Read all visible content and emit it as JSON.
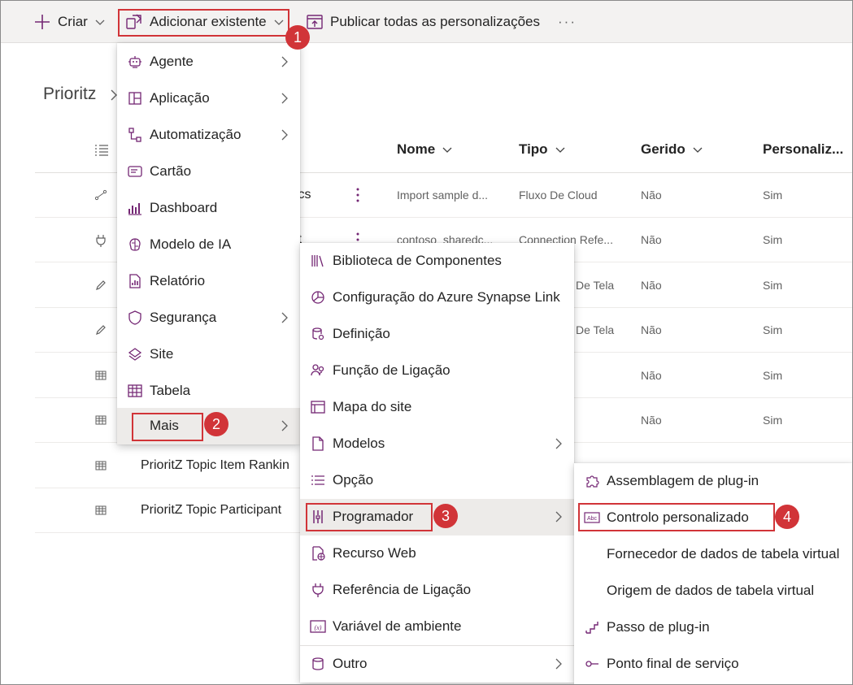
{
  "toolbar": {
    "create_label": "Criar",
    "add_existing_label": "Adicionar existente",
    "publish_label": "Publicar todas as personalizações",
    "more_label": "···"
  },
  "breadcrumb": {
    "text": "Prioritz"
  },
  "table": {
    "columns": [
      "Nome",
      "Tipo",
      "Gerido",
      "Personaliz..."
    ],
    "rows": [
      {
        "icon": "flow-icon",
        "name": "ics",
        "description": "Import sample d...",
        "type": "Fluxo De Cloud",
        "managed": "Não",
        "custom": "Sim"
      },
      {
        "icon": "plug-icon",
        "name": "it",
        "description": "contoso_sharedc...",
        "type": "Connection Refe...",
        "managed": "Não",
        "custom": "Sim"
      },
      {
        "icon": "pen-icon",
        "name": "",
        "description": "",
        "type": "De Tela",
        "managed": "Não",
        "custom": "Sim"
      },
      {
        "icon": "pen-icon",
        "name": "",
        "description": "",
        "type": "De Tela",
        "managed": "Não",
        "custom": "Sim"
      },
      {
        "icon": "table-icon",
        "name": "",
        "description": "",
        "type": "",
        "managed": "Não",
        "custom": "Sim"
      },
      {
        "icon": "table-icon",
        "name": "",
        "description": "",
        "type": "",
        "managed": "Não",
        "custom": "Sim"
      },
      {
        "icon": "table-icon",
        "name": "PrioritZ Topic Item Rankin",
        "description": "",
        "type": "",
        "managed": "",
        "custom": ""
      },
      {
        "icon": "table-icon",
        "name": "PrioritZ Topic Participant",
        "description": "",
        "type": "",
        "managed": "",
        "custom": ""
      }
    ]
  },
  "menu1": {
    "items": [
      {
        "label": "Agente",
        "icon": "bot-icon",
        "submenu": true
      },
      {
        "label": "Aplicação",
        "icon": "app-icon",
        "submenu": true
      },
      {
        "label": "Automatização",
        "icon": "automation-icon",
        "submenu": true
      },
      {
        "label": "Cartão",
        "icon": "card-icon",
        "submenu": false
      },
      {
        "label": "Dashboard",
        "icon": "dashboard-icon",
        "submenu": false
      },
      {
        "label": "Modelo de IA",
        "icon": "ai-model-icon",
        "submenu": false
      },
      {
        "label": "Relatório",
        "icon": "report-icon",
        "submenu": false
      },
      {
        "label": "Segurança",
        "icon": "shield-icon",
        "submenu": true
      },
      {
        "label": "Site",
        "icon": "site-icon",
        "submenu": false
      },
      {
        "label": "Tabela",
        "icon": "table-icon",
        "submenu": false
      },
      {
        "label": "Mais",
        "icon": "",
        "submenu": true
      }
    ]
  },
  "menu2": {
    "items": [
      {
        "label": "Biblioteca de Componentes",
        "icon": "library-icon",
        "submenu": false
      },
      {
        "label": "Configuração do Azure Synapse Link",
        "icon": "synapse-icon",
        "submenu": false
      },
      {
        "label": "Definição",
        "icon": "definition-icon",
        "submenu": false
      },
      {
        "label": "Função de Ligação",
        "icon": "connection-role-icon",
        "submenu": false
      },
      {
        "label": "Mapa do site",
        "icon": "sitemap-icon",
        "submenu": false
      },
      {
        "label": "Modelos",
        "icon": "template-icon",
        "submenu": true
      },
      {
        "label": "Opção",
        "icon": "option-icon",
        "submenu": false
      },
      {
        "label": "Programador",
        "icon": "developer-icon",
        "submenu": true
      },
      {
        "label": "Recurso Web",
        "icon": "web-resource-icon",
        "submenu": false
      },
      {
        "label": "Referência de Ligação",
        "icon": "plug-icon",
        "submenu": false
      },
      {
        "label": "Variável de ambiente",
        "icon": "variable-icon",
        "submenu": false
      },
      {
        "label": "Outro",
        "icon": "database-icon",
        "submenu": true
      }
    ]
  },
  "menu3": {
    "items": [
      {
        "label": "Assemblagem de plug-in",
        "icon": "puzzle-icon"
      },
      {
        "label": "Controlo personalizado",
        "icon": "custom-control-icon"
      },
      {
        "label": "Fornecedor de dados de tabela virtual",
        "icon": ""
      },
      {
        "label": "Origem de dados de tabela virtual",
        "icon": ""
      },
      {
        "label": "Passo de plug-in",
        "icon": "step-icon"
      },
      {
        "label": "Ponto final de serviço",
        "icon": "endpoint-icon"
      }
    ]
  },
  "callouts": [
    "1",
    "2",
    "3",
    "4"
  ],
  "colors": {
    "accent": "#742774",
    "callout": "#d13438",
    "toolbar_bg": "#f3f2f1",
    "active_bg": "#edebe9"
  }
}
